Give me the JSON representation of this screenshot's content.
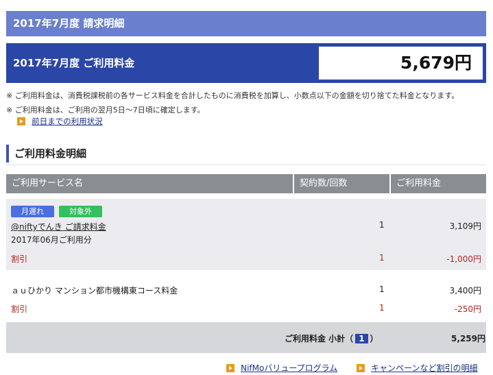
{
  "header": {
    "title": "2017年7月度 請求明細"
  },
  "total": {
    "label": "2017年7月度 ご利用料金",
    "amount": "5,679円"
  },
  "notes": [
    "※ ご利用料金は、消費税課税前の各サービス料金を合計したものに消費税を加算し、小数点以下の金額を切り捨てた料金となります。",
    "※ ご利用料金は、ご利用の翌月5日〜7日頃に確定します。"
  ],
  "usage_link": "前日までの利用状況",
  "section": {
    "title": "ご利用料金明細"
  },
  "table": {
    "headers": [
      "ご利用サービス名",
      "契約数/回数",
      "ご利用料金"
    ],
    "row1": {
      "badge_late": "月遅れ",
      "badge_excluded": "対象外",
      "service": "@niftyでんき ご請求料金",
      "period": "2017年06月ご利用分",
      "count": "1",
      "amount": "3,109円",
      "discount_label": "割引",
      "discount_count": "1",
      "discount_amount": "-1,000円"
    },
    "row2": {
      "service": "ａｕひかり マンション都市機構東コース料金",
      "count": "1",
      "amount": "3,400円",
      "discount_label": "割引",
      "discount_count": "1",
      "discount_amount": "-250円"
    },
    "subtotal": {
      "label": "ご利用料金 小計（",
      "count": "1",
      "close": "）",
      "amount": "5,259円"
    }
  },
  "footer_links": [
    "NifMoバリュープログラム",
    "キャンペーンなど割引の明細"
  ],
  "colors": {
    "header": "#6a7fcd",
    "total_bg": "#2a46a6",
    "accent": "#ea9a1b",
    "discount": "#b1241f"
  }
}
